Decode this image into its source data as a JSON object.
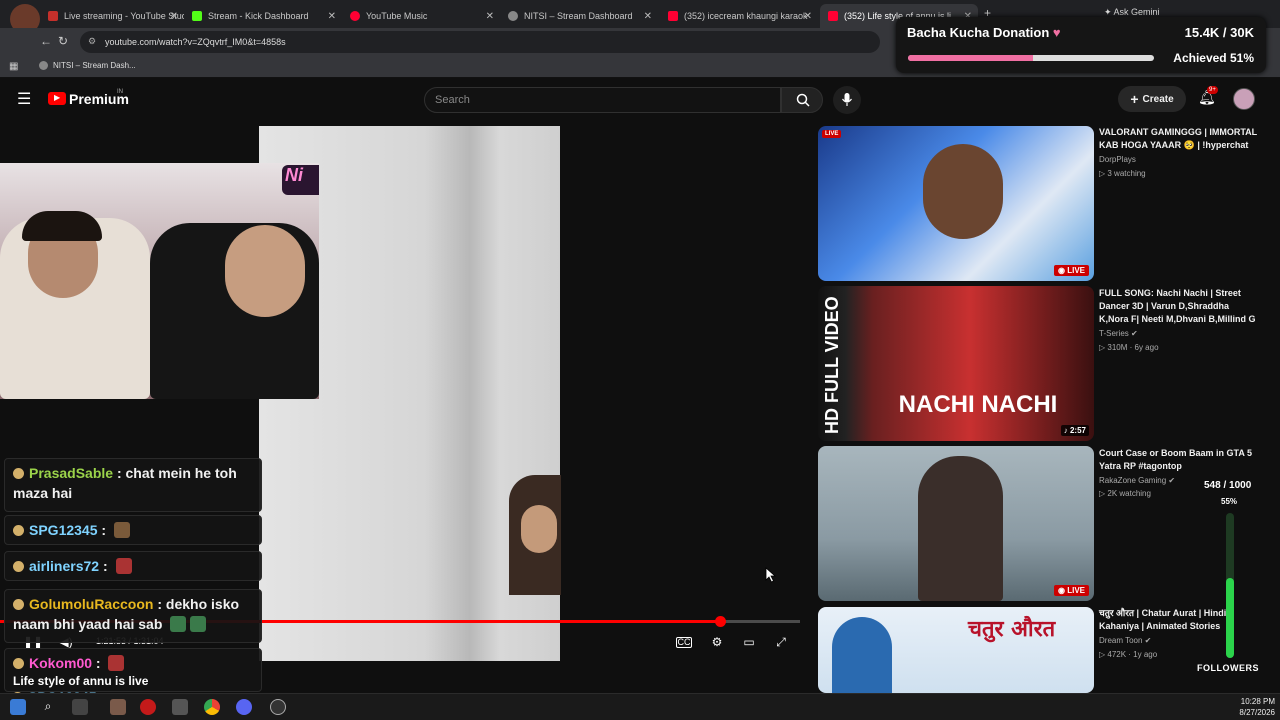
{
  "browser": {
    "tabs": [
      {
        "label": "Live streaming - YouTube Studi",
        "color": "#c4302b"
      },
      {
        "label": "Stream - Kick Dashboard",
        "color": "#53fc18"
      },
      {
        "label": "YouTube Music",
        "color": "#ff0033"
      },
      {
        "label": "NITSI – Stream Dashboard",
        "color": "#888888"
      },
      {
        "label": "(352) icecream khaungi karaok",
        "color": "#ff0033"
      },
      {
        "label": "(352) Life style of annu is li",
        "color": "#ff0033"
      }
    ],
    "new_tab": "+",
    "ask_gemini": "Ask Gemini",
    "url": "youtube.com/watch?v=ZQqvtrf_IM0&t=4858s",
    "bookmark": "NITSI – Stream Dash...",
    "profile_badge": "15"
  },
  "donation": {
    "title": "Bacha Kucha Donation",
    "amount": "15.4K / 30K",
    "status": "Achieved 51%",
    "progress": 0.51
  },
  "youtube": {
    "logo": "Premium",
    "region": "IN",
    "search_placeholder": "Search",
    "create_label": "Create",
    "notifications": "9+"
  },
  "player": {
    "time": "1:21:53 / 1:31:04",
    "progress": 0.9
  },
  "chat": [
    {
      "user": "PrasadSable",
      "user_color": "#9bd34a",
      "text": "chat mein he toh maza hai"
    },
    {
      "user": "SPG12345",
      "user_color": "#7fd3ff",
      "text": ""
    },
    {
      "user": "airliners72",
      "user_color": "#7fd3ff",
      "text": ""
    },
    {
      "user": "GolumoluRaccoon",
      "user_color": "#e8b81f",
      "text": "dekho isko naam bhi yaad hai sab"
    },
    {
      "user": "Kokom00",
      "user_color": "#ff5ad0",
      "text": ""
    },
    {
      "user": "SPG12345",
      "user_color": "#7fd3ff",
      "text": ""
    }
  ],
  "chat_overlay_text": "Life style of annu is live",
  "recommendations": [
    {
      "title": "VALORANT GAMINGGG | IMMORTAL KAB HOGA YAAAR 🥺 | !hyperchat",
      "channel": "DorpPlays",
      "meta": "3 watching",
      "badge": "LIVE",
      "tag": "LIVE"
    },
    {
      "title": "FULL SONG: Nachi Nachi | Street Dancer 3D | Varun D,Shraddha K,Nora F| Neeti M,Dhvani B,Millind G",
      "channel": "T-Series",
      "meta": "310M · 6y ago",
      "duration": "2:57",
      "thumb_text": "NACHI NACHI",
      "side_text": "HD FULL VIDEO"
    },
    {
      "title": "Court Case or Boom Baam in GTA 5 Yatra RP #tagontop",
      "channel": "RakaZone Gaming",
      "meta": "2K watching",
      "badge": "LIVE"
    },
    {
      "title": "चतुर औरत | Chatur Aurat | Hindi Kahaniya | Animated Stories",
      "channel": "Dream Toon",
      "meta": "472K · 1y ago",
      "thumb_text": "चतुर औरत"
    }
  ],
  "followers": {
    "count": "548 / 1000",
    "percent": "55%",
    "progress": 0.55,
    "label": "FOLLOWERS"
  },
  "taskbar": {
    "time": "10:28 PM",
    "date": "8/27/2026"
  }
}
